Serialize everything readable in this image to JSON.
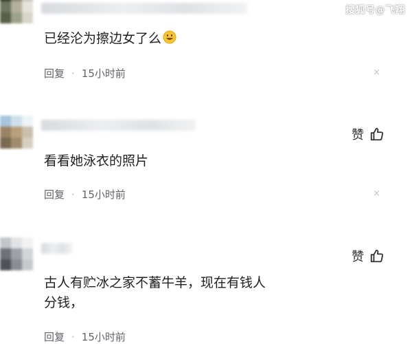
{
  "watermark": "搜狐号@飞翔",
  "reply_label": "回复",
  "separator_dot": "·",
  "like_label": "赞",
  "close_glyph": "×",
  "colors": {
    "background": "#ffffff",
    "text": "#1f1f1f",
    "meta": "#5f6368",
    "blur_placeholder": "#dfe2e5"
  },
  "comments": [
    {
      "text": "已经沦为擦边女了么",
      "emoji": "grinning-face-emoji",
      "time": "15小时前",
      "has_like": false,
      "has_close": true
    },
    {
      "text": "看看她泳衣的照片",
      "time": "15小时前",
      "has_like": true,
      "has_close": true
    },
    {
      "text": "古人有贮冰之家不蓄牛羊，现在有钱人\n分钱，",
      "time": "15小时前",
      "has_like": true,
      "has_close": false
    }
  ],
  "icons": {
    "like": "thumbs-up-icon",
    "close": "close-icon"
  }
}
